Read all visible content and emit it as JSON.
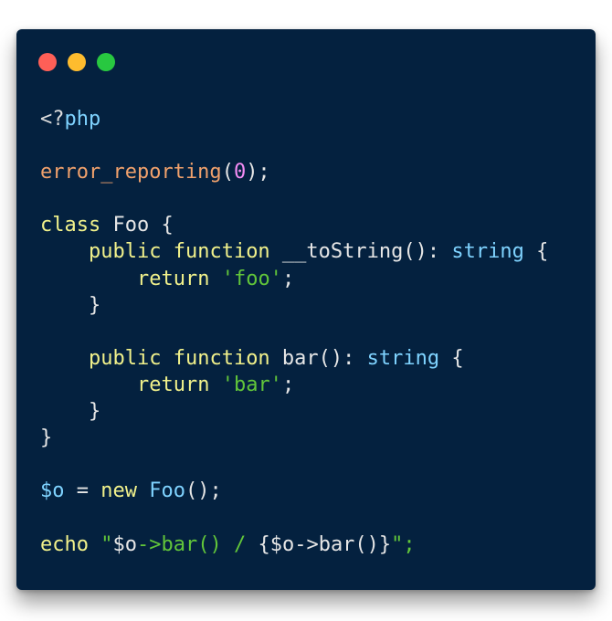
{
  "window": {
    "controls": [
      {
        "name": "close",
        "color": "#fe5f57"
      },
      {
        "name": "minimize",
        "color": "#febc2e"
      },
      {
        "name": "zoom",
        "color": "#28c840"
      }
    ]
  },
  "theme": {
    "background": "#04213f",
    "default": "#e6e6e6",
    "tag": "#dcdcdc",
    "php": "#7fd3ff",
    "func_call": "#f0a16c",
    "number": "#f58df5",
    "keyword": "#f1f18b",
    "classname": "#e6e6e6",
    "method": "#e6e6e6",
    "type": "#7fd3ff",
    "string": "#62c63a",
    "variable": "#7fd3ff",
    "punct": "#e6e6e6"
  },
  "code": {
    "lines": [
      [
        [
          "<?",
          "tag"
        ],
        [
          "php",
          "php"
        ]
      ],
      [],
      [
        [
          "error_reporting",
          "func_call"
        ],
        [
          "(",
          "punct"
        ],
        [
          "0",
          "number"
        ],
        [
          ");",
          "punct"
        ]
      ],
      [],
      [
        [
          "class",
          "keyword"
        ],
        [
          " Foo {",
          "classname"
        ]
      ],
      [
        [
          "    ",
          "default"
        ],
        [
          "public",
          "keyword"
        ],
        [
          " ",
          "default"
        ],
        [
          "function",
          "keyword"
        ],
        [
          " __toString(): ",
          "method"
        ],
        [
          "string",
          "type"
        ],
        [
          " {",
          "punct"
        ]
      ],
      [
        [
          "        ",
          "default"
        ],
        [
          "return",
          "keyword"
        ],
        [
          " ",
          "default"
        ],
        [
          "'foo'",
          "string"
        ],
        [
          ";",
          "punct"
        ]
      ],
      [
        [
          "    }",
          "punct"
        ]
      ],
      [],
      [
        [
          "    ",
          "default"
        ],
        [
          "public",
          "keyword"
        ],
        [
          " ",
          "default"
        ],
        [
          "function",
          "keyword"
        ],
        [
          " bar(): ",
          "method"
        ],
        [
          "string",
          "type"
        ],
        [
          " {",
          "punct"
        ]
      ],
      [
        [
          "        ",
          "default"
        ],
        [
          "return",
          "keyword"
        ],
        [
          " ",
          "default"
        ],
        [
          "'bar'",
          "string"
        ],
        [
          ";",
          "punct"
        ]
      ],
      [
        [
          "    }",
          "punct"
        ]
      ],
      [
        [
          "}",
          "punct"
        ]
      ],
      [],
      [
        [
          "$o",
          "variable"
        ],
        [
          " = ",
          "punct"
        ],
        [
          "new",
          "keyword"
        ],
        [
          " Foo",
          "type"
        ],
        [
          "();",
          "punct"
        ]
      ],
      [],
      [
        [
          "echo",
          "keyword"
        ],
        [
          " ",
          "default"
        ],
        [
          "\"",
          "string"
        ],
        [
          "$o",
          "default"
        ],
        [
          "->bar",
          "string"
        ],
        [
          "()",
          "string"
        ],
        [
          " / ",
          "string"
        ],
        [
          "{$o->bar()}",
          "default"
        ],
        [
          "\";",
          "string"
        ]
      ]
    ]
  }
}
